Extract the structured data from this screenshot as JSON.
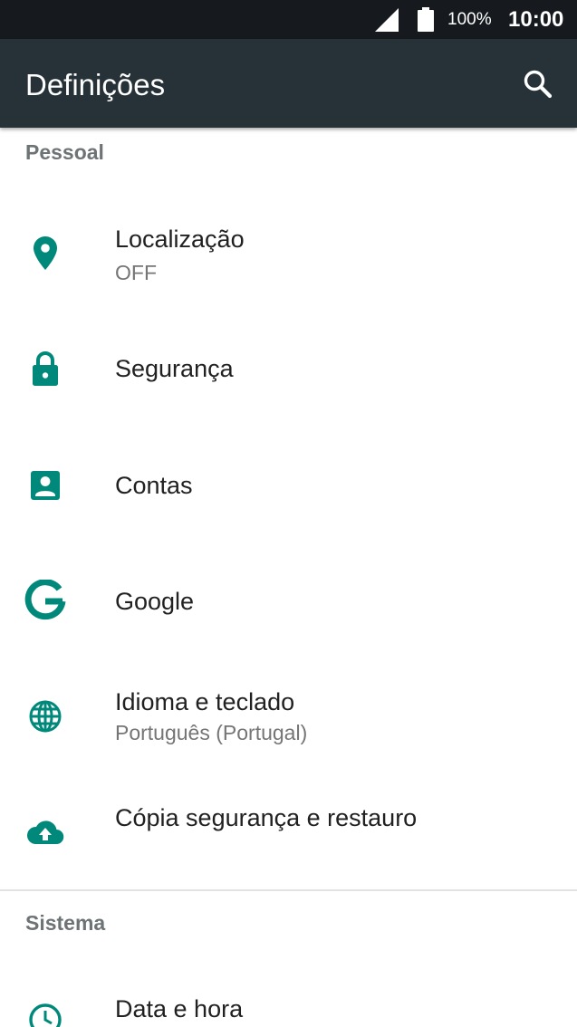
{
  "status_bar": {
    "battery_percent": "100%",
    "time": "10:00",
    "icons": [
      "signal-icon",
      "battery-icon"
    ]
  },
  "app_bar": {
    "title": "Definições",
    "search_icon": "search-icon"
  },
  "colors": {
    "status_bar_bg": "#161a1e",
    "app_bar_bg": "#263238",
    "icon_accent": "#00897b",
    "section_header": "#6e7375",
    "primary_text": "#212121",
    "secondary_text": "#757575"
  },
  "sections": [
    {
      "header": "Pessoal",
      "items": [
        {
          "label": "Localização",
          "summary": "OFF",
          "icon": "location-icon"
        },
        {
          "label": "Segurança",
          "icon": "lock-icon"
        },
        {
          "label": "Contas",
          "icon": "account-icon"
        },
        {
          "label": "Google",
          "icon": "google-icon"
        },
        {
          "label": "Idioma e teclado",
          "summary": "Português (Portugal)",
          "icon": "globe-icon"
        },
        {
          "label": "Cópia segurança e restauro",
          "icon": "cloud-upload-icon"
        }
      ]
    },
    {
      "header": "Sistema",
      "items": [
        {
          "label": "Data e hora",
          "icon": "clock-icon"
        }
      ]
    }
  ]
}
